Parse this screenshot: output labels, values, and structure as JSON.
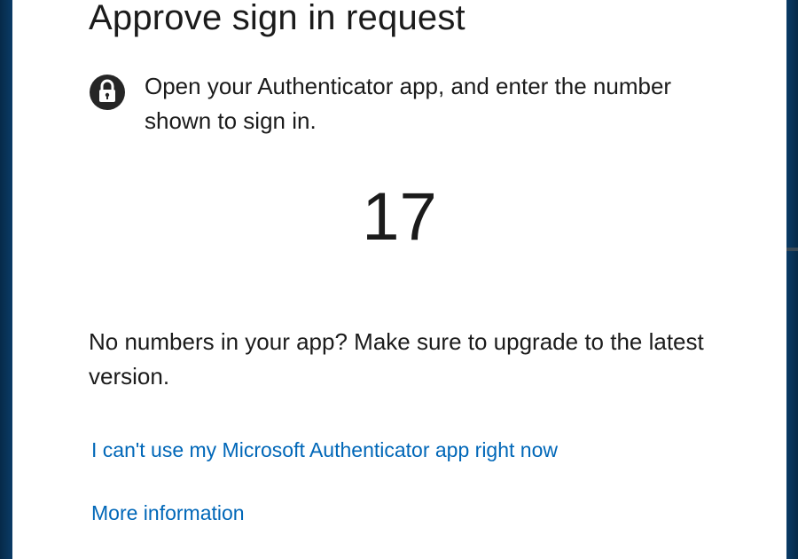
{
  "dialog": {
    "title": "Approve sign in request",
    "instruction": "Open your Authenticator app, and enter the number shown to sign in.",
    "instruction_icon": "lock-icon",
    "number": "17",
    "upgrade_note": "No numbers in your app? Make sure to upgrade to the latest version.",
    "links": {
      "cant_use": "I can't use my Microsoft Authenticator app right now",
      "more_info": "More information"
    }
  },
  "colors": {
    "background": "#0b3a63",
    "card": "#ffffff",
    "text": "#1b1b1b",
    "link": "#0067b8"
  }
}
